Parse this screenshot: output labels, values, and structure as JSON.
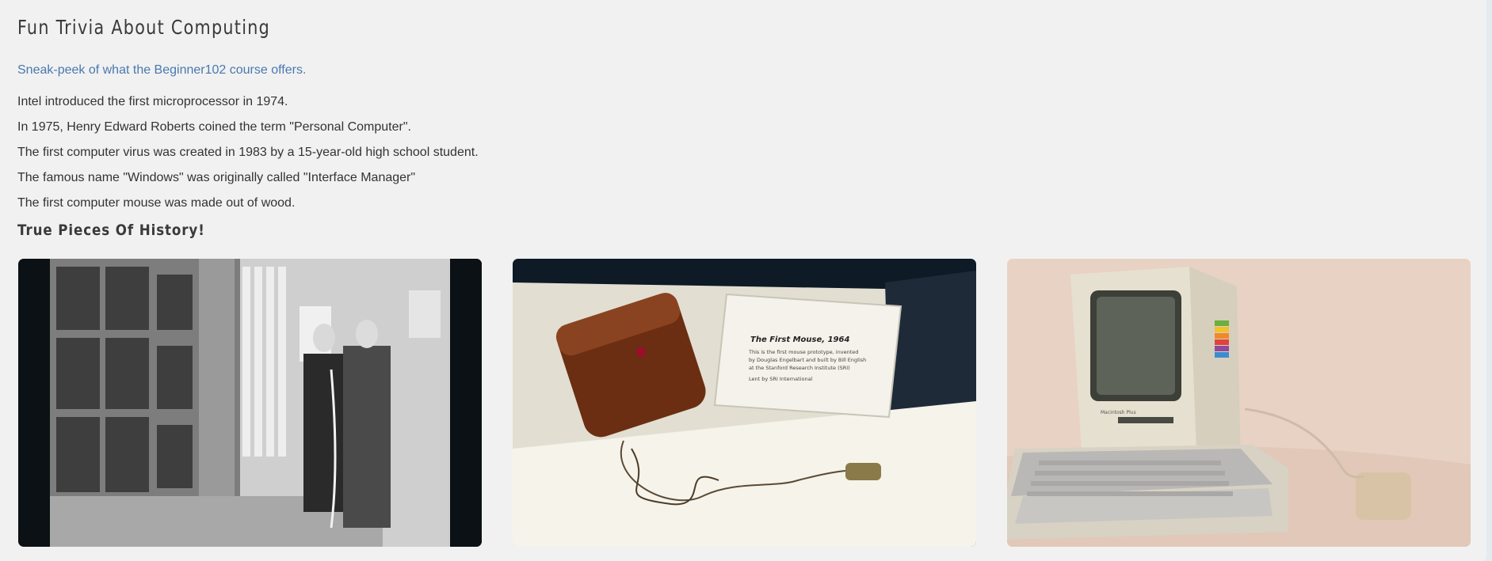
{
  "page": {
    "title": "Fun Trivia About Computing",
    "subtitle": "Sneak-peek of what the Beginner102 course offers."
  },
  "facts": [
    "Intel introduced the first microprocessor in 1974.",
    "In 1975, Henry Edward Roberts coined the term \"Personal Computer\".",
    "The first computer virus was created in 1983 by a 15-year-old high school student.",
    "The famous name \"Windows\" was originally called \"Interface Manager\"",
    "The first computer mouse was made out of wood."
  ],
  "history": {
    "heading": "True Pieces Of History!",
    "placard": {
      "title": "The First Mouse, 1964",
      "line1": "This is the first mouse prototype, invented",
      "line2": "by Douglas Engelbart and built by Bill English",
      "line3": "at the Stanford Research Institute (SRI)",
      "line4": "Lent by SRI International"
    },
    "mac_badge": "Macintosh Plus"
  },
  "colors": {
    "page_bg": "#f1f1f1",
    "subtitle": "#4a78b0",
    "text": "#333333"
  }
}
